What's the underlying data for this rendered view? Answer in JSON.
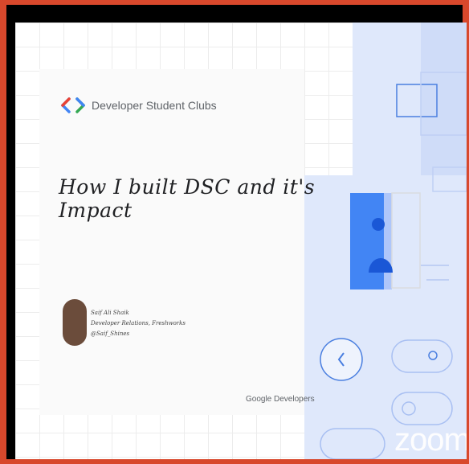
{
  "brand": {
    "name": "Developer Student Clubs"
  },
  "slide": {
    "title": "How I built DSC and it's Impact"
  },
  "speaker": {
    "name": "Saif Ali Shaik",
    "role": "Developer Relations, Freshworks",
    "handle": "@Saif_Shines"
  },
  "footer": {
    "google_developers": "Google Developers"
  },
  "watermark": {
    "text": "zoom"
  },
  "colors": {
    "frame_border": "#d8482c",
    "google_blue": "#4285f4",
    "google_red": "#ea4335",
    "google_green": "#34a853",
    "slide_blue": "#dfe8fb"
  },
  "icons": [
    "developer-logo-icon",
    "person-icon",
    "chevron-left-icon",
    "toggle-icon"
  ]
}
